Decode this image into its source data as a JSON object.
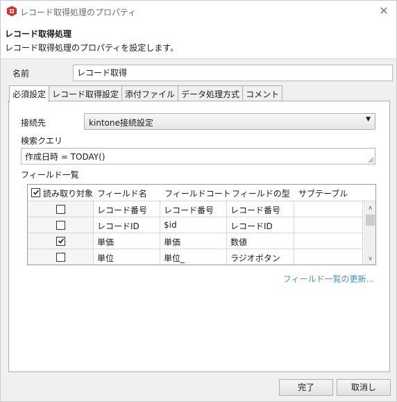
{
  "window": {
    "title": "レコード取得処理のプロパティ",
    "close_symbol": "✕"
  },
  "header": {
    "title": "レコード取得処理",
    "description": "レコード取得処理のプロパティを設定します。"
  },
  "name_field": {
    "label": "名前",
    "value": "レコード取得"
  },
  "tabs": [
    {
      "label": "必須設定",
      "active": true
    },
    {
      "label": "レコード取得設定",
      "active": false
    },
    {
      "label": "添付ファイル",
      "active": false
    },
    {
      "label": "データ処理方式",
      "active": false
    },
    {
      "label": "コメント",
      "active": false
    }
  ],
  "connection": {
    "label": "接続先",
    "selected": "kintone接続設定"
  },
  "query": {
    "label": "検索クエリ",
    "value": "作成日時 = TODAY()"
  },
  "field_list": {
    "label": "フィールド一覧",
    "columns": [
      "読み取り対象",
      "フィールド名",
      "フィールドコート",
      "フィールドの型",
      "サブテーブル"
    ],
    "header_checked": true,
    "rows": [
      {
        "checked": false,
        "name": "レコード番号",
        "code": "レコード番号",
        "type": "レコード番号",
        "subtable": ""
      },
      {
        "checked": false,
        "name": "レコードID",
        "code": "$id",
        "type": "レコードID",
        "subtable": ""
      },
      {
        "checked": true,
        "name": "単価",
        "code": "単価",
        "type": "数値",
        "subtable": ""
      },
      {
        "checked": false,
        "name": "単位",
        "code": "単位_",
        "type": "ラジオボタン",
        "subtable": ""
      }
    ],
    "refresh_link": "フィールド一覧の更新..."
  },
  "buttons": {
    "ok": "完了",
    "cancel": "取消し"
  },
  "colors": {
    "link": "#4a90d9",
    "app_icon": "#d9302c"
  }
}
